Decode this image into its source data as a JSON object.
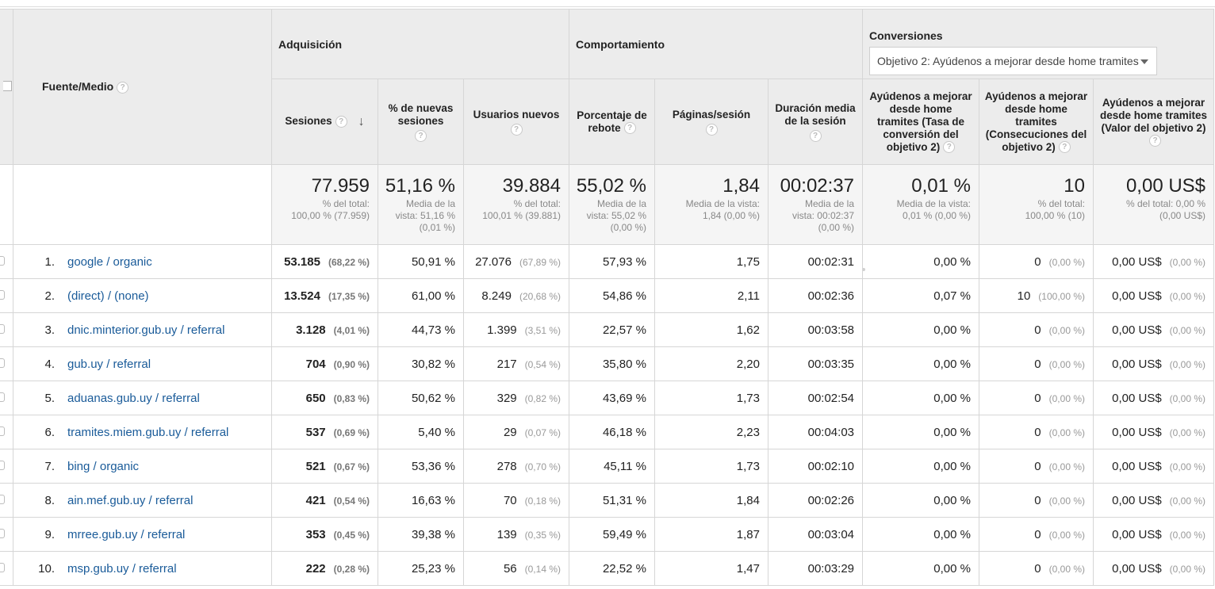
{
  "header": {
    "dimension_label": "Fuente/Medio",
    "groups": {
      "acquisition": "Adquisición",
      "behavior": "Comportamiento",
      "conversions": "Conversiones"
    },
    "goal_select": "Objetivo 2: Ayúdenos a mejorar desde home tramites",
    "help_glyph": "?",
    "sort_glyph": "↓",
    "columns": {
      "sessions": "Sesiones",
      "new_sessions_pct": "% de nuevas sesiones",
      "new_users": "Usuarios nuevos",
      "bounce_rate": "Porcentaje de rebote",
      "pages_per_session": "Páginas/sesión",
      "avg_duration": "Duración media de la sesión",
      "goal_rate": "Ayúdenos a mejorar desde home tramites (Tasa de conversión del objetivo 2)",
      "goal_completions": "Ayúdenos a mejorar desde home tramites (Consecuciones del objetivo 2)",
      "goal_value": "Ayúdenos a mejorar desde home tramites (Valor del objetivo 2)"
    }
  },
  "totals": {
    "sessions": {
      "value": "77.959",
      "sub1": "% del total:",
      "sub2": "100,00 % (77.959)"
    },
    "new_sessions_pct": {
      "value": "51,16 %",
      "sub1": "Media de la",
      "sub2": "vista: 51,16 %",
      "sub3": "(0,01 %)"
    },
    "new_users": {
      "value": "39.884",
      "sub1": "% del total:",
      "sub2": "100,01 % (39.881)"
    },
    "bounce_rate": {
      "value": "55,02 %",
      "sub1": "Media de la",
      "sub2": "vista: 55,02 %",
      "sub3": "(0,00 %)"
    },
    "pages_per_session": {
      "value": "1,84",
      "sub1": "Media de la vista:",
      "sub2": "1,84 (0,00 %)"
    },
    "avg_duration": {
      "value": "00:02:37",
      "sub1": "Media de la",
      "sub2": "vista: 00:02:37",
      "sub3": "(0,00 %)"
    },
    "goal_rate": {
      "value": "0,01 %",
      "sub1": "Media de la vista:",
      "sub2": "0,01 % (0,00 %)"
    },
    "goal_completions": {
      "value": "10",
      "sub1": "% del total:",
      "sub2": "100,00 % (10)"
    },
    "goal_value": {
      "value": "0,00 US$",
      "sub1": "% del total: 0,00 %",
      "sub2": "(0,00 US$)"
    }
  },
  "rows": [
    {
      "idx": "1.",
      "source": "google / organic",
      "sessions": "53.185",
      "sessions_pct": "(68,22 %)",
      "new_sessions": "50,91 %",
      "new_users": "27.076",
      "new_users_pct": "(67,89 %)",
      "bounce": "57,93 %",
      "pages": "1,75",
      "duration": "00:02:31",
      "goal_rate": "0,00 %",
      "goal_comp": "0",
      "goal_comp_pct": "(0,00 %)",
      "goal_value": "0,00 US$",
      "goal_value_pct": "(0,00 %)"
    },
    {
      "idx": "2.",
      "source": "(direct) / (none)",
      "sessions": "13.524",
      "sessions_pct": "(17,35 %)",
      "new_sessions": "61,00 %",
      "new_users": "8.249",
      "new_users_pct": "(20,68 %)",
      "bounce": "54,86 %",
      "pages": "2,11",
      "duration": "00:02:36",
      "goal_rate": "0,07 %",
      "goal_comp": "10",
      "goal_comp_pct": "(100,00 %)",
      "goal_value": "0,00 US$",
      "goal_value_pct": "(0,00 %)"
    },
    {
      "idx": "3.",
      "source": "dnic.minterior.gub.uy / referral",
      "sessions": "3.128",
      "sessions_pct": "(4,01 %)",
      "new_sessions": "44,73 %",
      "new_users": "1.399",
      "new_users_pct": "(3,51 %)",
      "bounce": "22,57 %",
      "pages": "1,62",
      "duration": "00:03:58",
      "goal_rate": "0,00 %",
      "goal_comp": "0",
      "goal_comp_pct": "(0,00 %)",
      "goal_value": "0,00 US$",
      "goal_value_pct": "(0,00 %)"
    },
    {
      "idx": "4.",
      "source": "gub.uy / referral",
      "sessions": "704",
      "sessions_pct": "(0,90 %)",
      "new_sessions": "30,82 %",
      "new_users": "217",
      "new_users_pct": "(0,54 %)",
      "bounce": "35,80 %",
      "pages": "2,20",
      "duration": "00:03:35",
      "goal_rate": "0,00 %",
      "goal_comp": "0",
      "goal_comp_pct": "(0,00 %)",
      "goal_value": "0,00 US$",
      "goal_value_pct": "(0,00 %)"
    },
    {
      "idx": "5.",
      "source": "aduanas.gub.uy / referral",
      "sessions": "650",
      "sessions_pct": "(0,83 %)",
      "new_sessions": "50,62 %",
      "new_users": "329",
      "new_users_pct": "(0,82 %)",
      "bounce": "43,69 %",
      "pages": "1,73",
      "duration": "00:02:54",
      "goal_rate": "0,00 %",
      "goal_comp": "0",
      "goal_comp_pct": "(0,00 %)",
      "goal_value": "0,00 US$",
      "goal_value_pct": "(0,00 %)"
    },
    {
      "idx": "6.",
      "source": "tramites.miem.gub.uy / referral",
      "sessions": "537",
      "sessions_pct": "(0,69 %)",
      "new_sessions": "5,40 %",
      "new_users": "29",
      "new_users_pct": "(0,07 %)",
      "bounce": "46,18 %",
      "pages": "2,23",
      "duration": "00:04:03",
      "goal_rate": "0,00 %",
      "goal_comp": "0",
      "goal_comp_pct": "(0,00 %)",
      "goal_value": "0,00 US$",
      "goal_value_pct": "(0,00 %)"
    },
    {
      "idx": "7.",
      "source": "bing / organic",
      "sessions": "521",
      "sessions_pct": "(0,67 %)",
      "new_sessions": "53,36 %",
      "new_users": "278",
      "new_users_pct": "(0,70 %)",
      "bounce": "45,11 %",
      "pages": "1,73",
      "duration": "00:02:10",
      "goal_rate": "0,00 %",
      "goal_comp": "0",
      "goal_comp_pct": "(0,00 %)",
      "goal_value": "0,00 US$",
      "goal_value_pct": "(0,00 %)"
    },
    {
      "idx": "8.",
      "source": "ain.mef.gub.uy / referral",
      "sessions": "421",
      "sessions_pct": "(0,54 %)",
      "new_sessions": "16,63 %",
      "new_users": "70",
      "new_users_pct": "(0,18 %)",
      "bounce": "51,31 %",
      "pages": "1,84",
      "duration": "00:02:26",
      "goal_rate": "0,00 %",
      "goal_comp": "0",
      "goal_comp_pct": "(0,00 %)",
      "goal_value": "0,00 US$",
      "goal_value_pct": "(0,00 %)"
    },
    {
      "idx": "9.",
      "source": "mrree.gub.uy / referral",
      "sessions": "353",
      "sessions_pct": "(0,45 %)",
      "new_sessions": "39,38 %",
      "new_users": "139",
      "new_users_pct": "(0,35 %)",
      "bounce": "59,49 %",
      "pages": "1,87",
      "duration": "00:03:04",
      "goal_rate": "0,00 %",
      "goal_comp": "0",
      "goal_comp_pct": "(0,00 %)",
      "goal_value": "0,00 US$",
      "goal_value_pct": "(0,00 %)"
    },
    {
      "idx": "10.",
      "source": "msp.gub.uy / referral",
      "sessions": "222",
      "sessions_pct": "(0,28 %)",
      "new_sessions": "25,23 %",
      "new_users": "56",
      "new_users_pct": "(0,14 %)",
      "bounce": "22,52 %",
      "pages": "1,47",
      "duration": "00:03:29",
      "goal_rate": "0,00 %",
      "goal_comp": "0",
      "goal_comp_pct": "(0,00 %)",
      "goal_value": "0,00 US$",
      "goal_value_pct": "(0,00 %)"
    }
  ],
  "colors": {
    "link": "#1a5b99",
    "header_bg": "#ececec",
    "totals_bg": "#f5f5f5",
    "border": "#d6d6d6"
  }
}
